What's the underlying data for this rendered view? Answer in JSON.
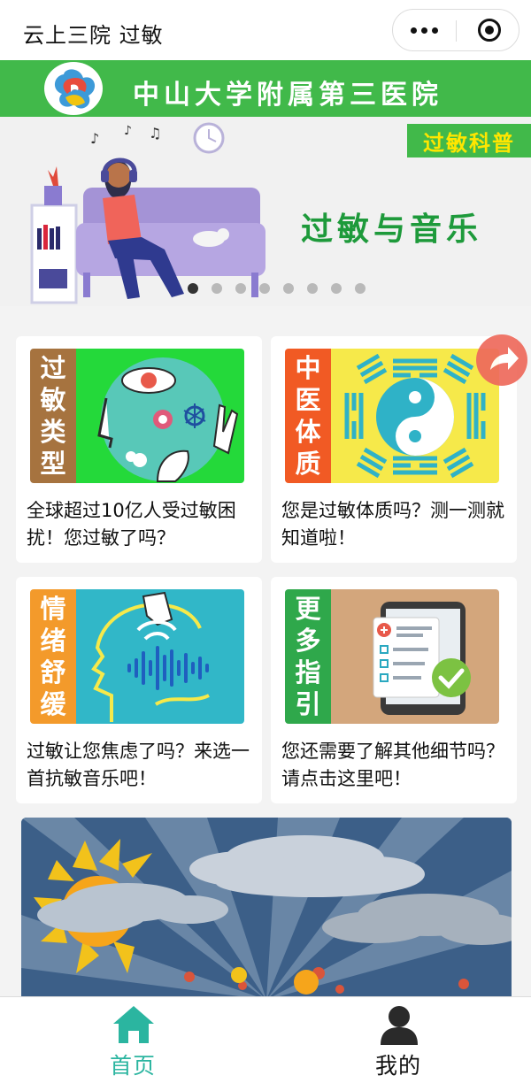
{
  "app": {
    "title": "云上三院 过敏"
  },
  "header": {
    "hospital_name": "中山大学附属第三医院"
  },
  "carousel": {
    "tag": "过敏科普",
    "title": "过敏与音乐",
    "slide_count": 8,
    "active_index": 0
  },
  "cards": [
    {
      "tag_chars": [
        "过",
        "敏",
        "类",
        "型"
      ],
      "tag_color": "#a6733f",
      "art_bg": "#24d93a",
      "text": "全球超过10亿人受过敏困扰！您过敏了吗？"
    },
    {
      "tag_chars": [
        "中",
        "医",
        "体",
        "质"
      ],
      "tag_color": "#f15a24",
      "art_bg": "#f6e94a",
      "text": "您是过敏体质吗？测一测就知道啦！"
    },
    {
      "tag_chars": [
        "情",
        "绪",
        "舒",
        "缓"
      ],
      "tag_color": "#f39a2b",
      "art_bg": "#31b7c8",
      "text": "过敏让您焦虑了吗？来选一首抗敏音乐吧！"
    },
    {
      "tag_chars": [
        "更",
        "多",
        "指",
        "引"
      ],
      "tag_color": "#2fa84b",
      "art_bg": "#d3a67c",
      "text": "您还需要了解其他细节吗？请点击这里吧！"
    }
  ],
  "tabs": [
    {
      "label": "首页",
      "active": true
    },
    {
      "label": "我的",
      "active": false
    }
  ],
  "colors": {
    "brand_green": "#41b94a",
    "tab_active": "#2bb5a0",
    "tab_inactive": "#111111"
  }
}
